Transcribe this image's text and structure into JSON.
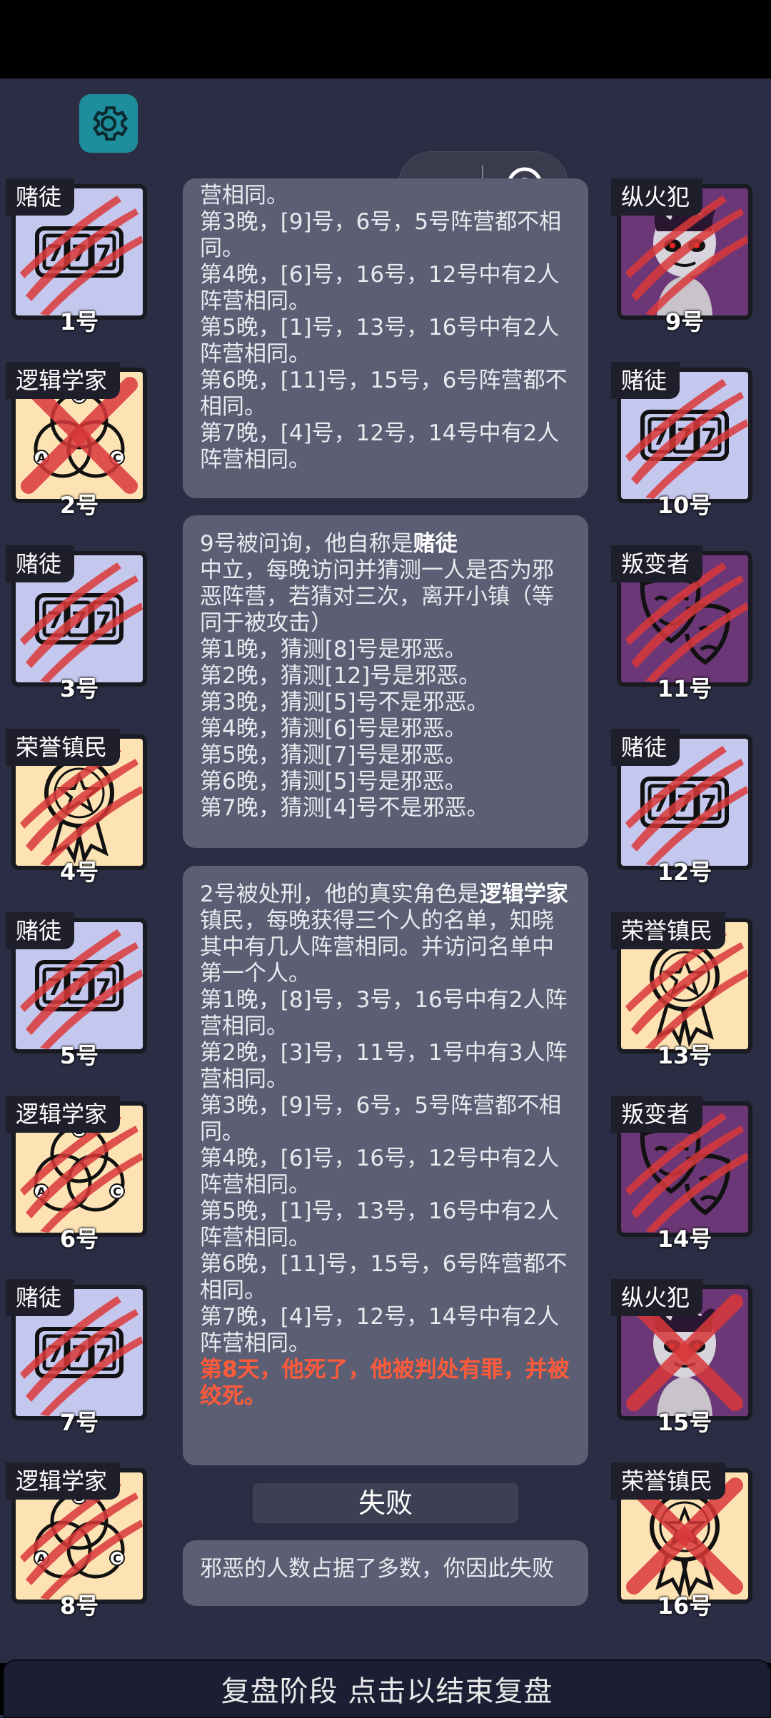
{
  "players": [
    {
      "num": "1号",
      "role": "赌徒",
      "icon": "slot-machine-icon",
      "bg": "blue",
      "dead": false,
      "crossed": false
    },
    {
      "num": "2号",
      "role": "逻辑学家",
      "icon": "venn-diagram-icon",
      "bg": "orange",
      "dead": true,
      "crossed": true
    },
    {
      "num": "3号",
      "role": "赌徒",
      "icon": "slot-machine-icon",
      "bg": "blue",
      "dead": false,
      "crossed": false
    },
    {
      "num": "4号",
      "role": "荣誉镇民",
      "icon": "medal-icon",
      "bg": "orange",
      "dead": false,
      "crossed": false
    },
    {
      "num": "5号",
      "role": "赌徒",
      "icon": "slot-machine-icon",
      "bg": "blue",
      "dead": false,
      "crossed": false
    },
    {
      "num": "6号",
      "role": "逻辑学家",
      "icon": "venn-diagram-icon",
      "bg": "orange",
      "dead": false,
      "crossed": false
    },
    {
      "num": "7号",
      "role": "赌徒",
      "icon": "slot-machine-icon",
      "bg": "blue",
      "dead": false,
      "crossed": false
    },
    {
      "num": "8号",
      "role": "逻辑学家",
      "icon": "venn-diagram-icon",
      "bg": "orange",
      "dead": false,
      "crossed": false
    },
    {
      "num": "9号",
      "role": "纵火犯",
      "icon": "arsonist-icon",
      "bg": "purple",
      "dead": false,
      "crossed": false
    },
    {
      "num": "10号",
      "role": "赌徒",
      "icon": "slot-machine-icon",
      "bg": "blue",
      "dead": false,
      "crossed": false
    },
    {
      "num": "11号",
      "role": "叛变者",
      "icon": "theater-mask-icon",
      "bg": "purple",
      "dead": false,
      "crossed": false
    },
    {
      "num": "12号",
      "role": "赌徒",
      "icon": "slot-machine-icon",
      "bg": "blue",
      "dead": false,
      "crossed": false
    },
    {
      "num": "13号",
      "role": "荣誉镇民",
      "icon": "medal-icon",
      "bg": "orange",
      "dead": false,
      "crossed": false
    },
    {
      "num": "14号",
      "role": "叛变者",
      "icon": "theater-mask-icon",
      "bg": "purple",
      "dead": false,
      "crossed": false
    },
    {
      "num": "15号",
      "role": "纵火犯",
      "icon": "arsonist-icon",
      "bg": "purple",
      "dead": true,
      "crossed": true
    },
    {
      "num": "16号",
      "role": "荣誉镇民",
      "icon": "medal-icon",
      "bg": "orange",
      "dead": true,
      "crossed": true
    }
  ],
  "log": {
    "top_partial": [
      "营相同。",
      "第3晚，[9]号，6号，5号阵营都不相同。",
      "第4晚，[6]号，16号，12号中有2人阵营相同。",
      "第5晚，[1]号，13号，16号中有2人阵营相同。",
      "第6晚，[11]号，15号，6号阵营都不相同。",
      "第7晚，[4]号，12号，14号中有2人阵营相同。"
    ],
    "msg2_title": "9号被问询，他自称是",
    "msg2_title_bold": "赌徒",
    "msg2_lines": [
      "中立，每晚访问并猜测一人是否为邪恶阵营，若猜对三次，离开小镇（等同于被攻击）",
      "第1晚，猜测[8]号是邪恶。",
      "第2晚，猜测[12]号是邪恶。",
      "第3晚，猜测[5]号不是邪恶。",
      "第4晚，猜测[6]号是邪恶。",
      "第5晚，猜测[7]号是邪恶。",
      "第6晚，猜测[5]号是邪恶。",
      "第7晚，猜测[4]号不是邪恶。"
    ],
    "msg3_title": "2号被处刑，他的真实角色是",
    "msg3_title_bold": "逻辑学家",
    "msg3_lines": [
      "镇民，每晚获得三个人的名单，知晓其中有几人阵营相同。并访问名单中第一个人。",
      "第1晚，[8]号，3号，16号中有2人阵营相同。",
      "第2晚，[3]号，11号，1号中有3人阵营相同。",
      "第3晚，[9]号，6号，5号阵营都不相同。",
      "第4晚，[6]号，16号，12号中有2人阵营相同。",
      "第5晚，[1]号，13号，16号中有2人阵营相同。",
      "第6晚，[11]号，15号，6号阵营都不相同。",
      "第7晚，[4]号，12号，14号中有2人阵营相同。"
    ],
    "msg3_red": "第8天，他死了，他被判处有罪，并被绞死。"
  },
  "result_label": "失败",
  "result_msg": "邪恶的人数占据了多数，你因此失败",
  "bottom_label": "复盘阶段 点击以结束复盘",
  "colors": {
    "blue": "#c5c8ee",
    "orange": "#fde3b4",
    "purple": "#6b3776",
    "claw": "#d9383a",
    "red_text": "#ff5a3a"
  }
}
